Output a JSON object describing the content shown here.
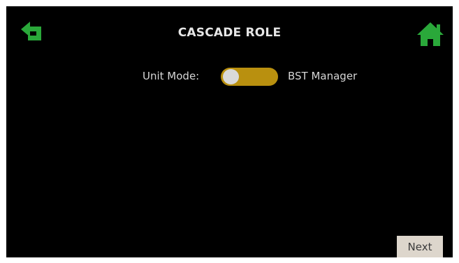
{
  "header": {
    "title": "CASCADE ROLE",
    "back_icon": "back-arrow-icon",
    "home_icon": "home-icon"
  },
  "unit_mode": {
    "label": "Unit Mode:",
    "value": "BST Manager",
    "toggle_color": "#b9900f",
    "knob_color": "#d9d9d9"
  },
  "footer": {
    "next_label": "Next"
  },
  "colors": {
    "accent_green": "#2aa83a",
    "background": "#000000"
  }
}
